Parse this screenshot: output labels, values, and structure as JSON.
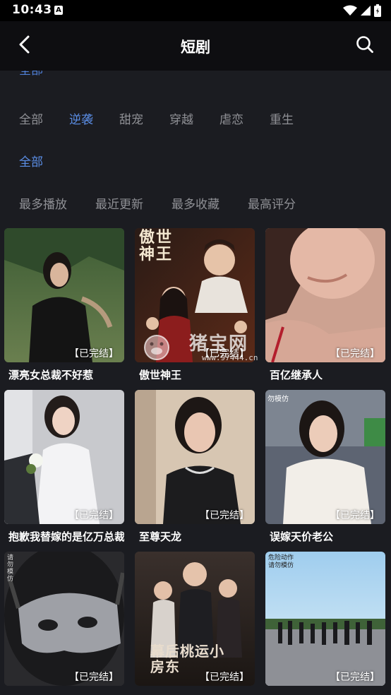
{
  "status_bar": {
    "time": "10:43",
    "notification_letter": "A",
    "icons": [
      "wifi-icon",
      "signal-icon",
      "battery-icon"
    ]
  },
  "header": {
    "title": "短剧",
    "back_icon": "chevron-left-icon",
    "search_icon": "search-icon"
  },
  "filters": {
    "partial_row": "全部",
    "genre": [
      "全部",
      "逆袭",
      "甜宠",
      "穿越",
      "虐恋",
      "重生"
    ],
    "genre_selected": "逆袭",
    "status": [
      "全部"
    ],
    "status_selected": "全部",
    "sort": [
      "最多播放",
      "最近更新",
      "最多收藏",
      "最高评分"
    ]
  },
  "colors": {
    "background": "#1b1c21",
    "header": "#0e0e11",
    "accent": "#5b8ee6",
    "inactive": "#8f9095"
  },
  "dramas": [
    {
      "title": "漂亮女总裁不好惹",
      "badge": "【已完结】"
    },
    {
      "title": "傲世神王",
      "badge": "【已完结】",
      "poster_text": "傲世神王"
    },
    {
      "title": "百亿继承人",
      "badge": "【已完结】"
    },
    {
      "title": "抱歉我替嫁的是亿万总裁",
      "badge": "【已完结】"
    },
    {
      "title": "至尊天龙",
      "badge": "【已完结】"
    },
    {
      "title": "误嫁天价老公",
      "badge": "【已完结】",
      "poster_text": "勿模仿"
    },
    {
      "title": "",
      "badge": "【已完结】",
      "poster_text": "请勿模仿"
    },
    {
      "title": "",
      "badge": "【已完结】",
      "poster_text": "幕后桃运小房东"
    },
    {
      "title": "",
      "badge": "【已完结】",
      "poster_text": "危险动作 请勿模仿"
    }
  ],
  "watermark": {
    "text": "猪宝网",
    "url": "www.97444.cn"
  }
}
